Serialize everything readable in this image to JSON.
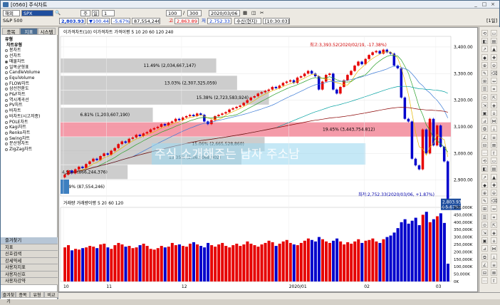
{
  "window": {
    "title": "[0560] 주식차트",
    "top_right": "[1일]"
  },
  "toolbar": {
    "market": "해외",
    "symbol_code": "SPX",
    "mode_label": "주",
    "mode2_label": "일",
    "period_value": "1",
    "count_value": "100",
    "total_count": "300",
    "date_value": "2020/03/06",
    "symbol_name": "S&P 500",
    "price": "2,803.93",
    "change": "▼100.44",
    "change_pct": "-5.67%",
    "volume": "87,554,246",
    "high_label": "고",
    "high": "2,863.89",
    "low_label": "저",
    "low": "2,752.33",
    "realtime_label": "수신(현지)",
    "time": "[10:30:03]"
  },
  "sidebar": {
    "tabs": [
      "종목",
      "지표",
      "시스템"
    ],
    "tree_header": "유형",
    "tree_group": "차트유형",
    "items": [
      "봉차트",
      "선차트",
      "매물차트",
      "일목균형표",
      "CandleVolume",
      "EquiVolume",
      "FLOW차트",
      "삼선전환도",
      "P&F차트",
      "역시계곡선",
      "PV차트",
      "바차트",
      "바차트(시고저종)",
      "POLE차트",
      "Kagi차트",
      "Renko차트",
      "Swing차트",
      "분산형차트",
      "ZigZag차트"
    ],
    "bottom_items": [
      "즐겨찾기",
      "지표",
      "신호검색",
      "강세약세",
      "사용자지표",
      "사용자신호",
      "사용자강약"
    ],
    "bottom_tabs": [
      "즐겨찾기",
      "종목",
      "유형",
      "비교"
    ]
  },
  "legend": {
    "price": [
      "이가격차트(10)",
      "이가격차트",
      "가격이평 5",
      "10",
      "20",
      "60",
      "120",
      "240"
    ],
    "volume": [
      "거래량",
      "거래량이평 5",
      "20",
      "60",
      "120"
    ]
  },
  "colors": {
    "up": "#e60000",
    "down": "#0000cc",
    "band": "#f28a9a",
    "grey": "#c8c8c8"
  },
  "chart_data": {
    "type": "candlestick",
    "title": "",
    "ylim": [
      2840,
      3440
    ],
    "y_ticks": [
      "3,400.00",
      "3,300.00",
      "3,200.00",
      "3,100.00",
      "3,000.00",
      "2,900.00"
    ],
    "x_ticks": [
      "10",
      "11",
      "12",
      "2020/01",
      "02",
      "03"
    ],
    "volume_ticks": [
      "500,000K",
      "450,000K",
      "400,000K",
      "350,000K",
      "300,000K",
      "250,000K",
      "200,000K",
      "150,000K",
      "100,000K",
      "50,000K",
      "0K"
    ],
    "profile": [
      {
        "label": "11.49% (2,034,667,147)",
        "price": 3330,
        "pct": 11.49
      },
      {
        "label": "13.03% (2,307,325,059)",
        "price": 3265,
        "pct": 13.03
      },
      {
        "label": "15.38% (2,723,583,924)",
        "price": 3210,
        "pct": 15.38
      },
      {
        "label": "6.81% (1,203,607,190)",
        "price": 3145,
        "pct": 6.81
      },
      {
        "label": "19.45% (3,443,754,812)",
        "price": 3090,
        "pct": 19.45
      },
      {
        "label": "15.06% (2,665,528,860)",
        "price": 3035,
        "pct": 15.06
      },
      {
        "label": "13.35% (2,362,068,902)",
        "price": 2985,
        "pct": 13.35
      },
      {
        "label": "4.95% (866,244,376)",
        "price": 2930,
        "pct": 4.95
      },
      {
        "label": "0.49% (87,554,246)",
        "price": 2875,
        "pct": 0.49
      }
    ],
    "annotations": {
      "high": "최고:3,393.52(2020/02/19, -17.38%)",
      "low": "최저:2,752.33(2020/03/06, +1.87%)",
      "last_price": "2,803.93",
      "last_pct": "(-5.67%)",
      "watermark": "주식 소개해주는 남자 주소남"
    },
    "candles": [
      [
        2910,
        2920
      ],
      [
        2920,
        2935
      ],
      [
        2935,
        2925
      ],
      [
        2925,
        2940
      ],
      [
        2940,
        2950
      ],
      [
        2950,
        2945
      ],
      [
        2945,
        2960
      ],
      [
        2960,
        2970
      ],
      [
        2970,
        2980
      ],
      [
        2980,
        2975
      ],
      [
        2975,
        2990
      ],
      [
        2990,
        3000
      ],
      [
        3000,
        2995
      ],
      [
        2995,
        3010
      ],
      [
        3010,
        3020
      ],
      [
        3020,
        3035
      ],
      [
        3035,
        3045
      ],
      [
        3045,
        3040
      ],
      [
        3040,
        3055
      ],
      [
        3055,
        3060
      ],
      [
        3060,
        3070
      ],
      [
        3070,
        3065
      ],
      [
        3065,
        3075
      ],
      [
        3075,
        3080
      ],
      [
        3080,
        3090
      ],
      [
        3090,
        3095
      ],
      [
        3095,
        3100
      ],
      [
        3100,
        3110
      ],
      [
        3110,
        3105
      ],
      [
        3105,
        3115
      ],
      [
        3115,
        3120
      ],
      [
        3120,
        3130
      ],
      [
        3130,
        3125
      ],
      [
        3125,
        3135
      ],
      [
        3135,
        3140
      ],
      [
        3140,
        3145
      ],
      [
        3145,
        3140
      ],
      [
        3140,
        3150
      ],
      [
        3150,
        3145
      ],
      [
        3145,
        3120
      ],
      [
        3120,
        3110
      ],
      [
        3110,
        3125
      ],
      [
        3125,
        3140
      ],
      [
        3140,
        3145
      ],
      [
        3145,
        3150
      ],
      [
        3150,
        3155
      ],
      [
        3155,
        3165
      ],
      [
        3165,
        3170
      ],
      [
        3170,
        3175
      ],
      [
        3175,
        3180
      ],
      [
        3180,
        3190
      ],
      [
        3190,
        3200
      ],
      [
        3200,
        3210
      ],
      [
        3210,
        3215
      ],
      [
        3215,
        3225
      ],
      [
        3225,
        3230
      ],
      [
        3230,
        3235
      ],
      [
        3235,
        3240
      ],
      [
        3240,
        3250
      ],
      [
        3250,
        3245
      ],
      [
        3245,
        3255
      ],
      [
        3255,
        3265
      ],
      [
        3265,
        3270
      ],
      [
        3270,
        3275
      ],
      [
        3275,
        3265
      ],
      [
        3265,
        3285
      ],
      [
        3285,
        3290
      ],
      [
        3290,
        3300
      ],
      [
        3300,
        3310
      ],
      [
        3310,
        3300
      ],
      [
        3300,
        3290
      ],
      [
        3290,
        3240
      ],
      [
        3240,
        3270
      ],
      [
        3270,
        3295
      ],
      [
        3295,
        3300
      ],
      [
        3300,
        3240
      ],
      [
        3240,
        3225
      ],
      [
        3225,
        3250
      ],
      [
        3250,
        3275
      ],
      [
        3275,
        3295
      ],
      [
        3295,
        3310
      ],
      [
        3310,
        3330
      ],
      [
        3330,
        3345
      ],
      [
        3345,
        3335
      ],
      [
        3335,
        3355
      ],
      [
        3355,
        3370
      ],
      [
        3370,
        3380
      ],
      [
        3380,
        3385
      ],
      [
        3385,
        3375
      ],
      [
        3375,
        3390
      ],
      [
        3390,
        3380
      ],
      [
        3380,
        3375
      ],
      [
        3375,
        3330
      ],
      [
        3330,
        3320
      ],
      [
        3320,
        3210
      ],
      [
        3210,
        3130
      ],
      [
        3130,
        3120
      ],
      [
        3120,
        2980
      ],
      [
        2980,
        2955
      ],
      [
        2955,
        2940
      ],
      [
        2940,
        3090
      ],
      [
        3090,
        3000
      ],
      [
        3000,
        3130
      ],
      [
        3130,
        3030
      ],
      [
        3030,
        3105
      ],
      [
        3105,
        3025
      ],
      [
        3025,
        2970
      ],
      [
        2970,
        2804
      ]
    ],
    "volumes": [
      230,
      245,
      210,
      220,
      215,
      225,
      230,
      240,
      235,
      225,
      250,
      255,
      230,
      220,
      245,
      260,
      250,
      235,
      240,
      225,
      230,
      245,
      255,
      240,
      220,
      215,
      225,
      240,
      230,
      235,
      260,
      245,
      250,
      240,
      235,
      255,
      265,
      250,
      240,
      230,
      260,
      245,
      235,
      250,
      260,
      240,
      230,
      245,
      255,
      240,
      250,
      270,
      255,
      245,
      235,
      250,
      260,
      275,
      265,
      240,
      255,
      270,
      280,
      260,
      250,
      245,
      260,
      275,
      290,
      280,
      270,
      300,
      285,
      270,
      260,
      275,
      290,
      270,
      250,
      265,
      255,
      270,
      285,
      260,
      275,
      280,
      290,
      270,
      260,
      285,
      300,
      310,
      330,
      360,
      400,
      420,
      390,
      410,
      430,
      380,
      450,
      470,
      400,
      420,
      440,
      460,
      395,
      120
    ]
  },
  "statusbar": {
    "text": ""
  }
}
